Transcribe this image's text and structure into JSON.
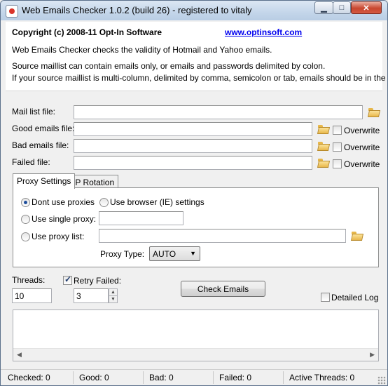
{
  "window": {
    "title": "Web Emails Checker 1.0.2 (build 26) - registered to vitaly",
    "minimize_glyph": "▁",
    "maximize_glyph": "□",
    "close_glyph": "✕"
  },
  "info": {
    "copyright": "Copyright (c) 2008-11 Opt-In Software",
    "website": "www.optinsoft.com",
    "description": "Web Emails Checker checks the validity of Hotmail and Yahoo emails.",
    "source_note_1": "Source maillist can contain emails only, or emails and passwords delimited by colon.",
    "source_note_2": "If your source maillist is multi-column, delimited by comma, semicolon or tab, emails should be in the first column."
  },
  "files": {
    "mail_list_label": "Mail list file:",
    "mail_list_value": "",
    "good_label": "Good emails file:",
    "good_value": "",
    "bad_label": "Bad emails file:",
    "bad_value": "",
    "failed_label": "Failed file:",
    "failed_value": "",
    "overwrite_label": "Overwrite",
    "good_overwrite": false,
    "bad_overwrite": false,
    "failed_overwrite": false
  },
  "tabs": [
    {
      "label": "Proxy Settings",
      "active": true
    },
    {
      "label": "IP Rotation",
      "active": false
    }
  ],
  "proxy": {
    "dont_use_label": "Dont use proxies",
    "browser_label": "Use browser (IE) settings",
    "single_label": "Use single proxy:",
    "list_label": "Use proxy list:",
    "single_value": "",
    "list_value": "",
    "selected": "dont_use",
    "type_label": "Proxy Type:",
    "type_value": "AUTO"
  },
  "options": {
    "threads_label": "Threads:",
    "threads_value": "10",
    "retry_label": "Retry Failed:",
    "retry_checked": true,
    "retry_value": "3",
    "check_button": "Check Emails",
    "detailed_log_label": "Detailed Log",
    "detailed_log_checked": false
  },
  "status": {
    "checked": "Checked: 0",
    "good": "Good: 0",
    "bad": "Bad: 0",
    "failed": "Failed: 0",
    "active_threads": "Active Threads: 0"
  }
}
